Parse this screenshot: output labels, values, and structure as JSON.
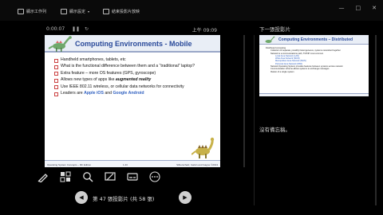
{
  "titlebar": {
    "items": [
      "顯示工作列",
      "顯示設定",
      "結束投影片放映"
    ],
    "controls": [
      "—",
      "□",
      "✕"
    ]
  },
  "presenter": {
    "elapsed": "0:00:07",
    "clock": "上午 09:09",
    "counter": "第 47 張投影片 (共 58 張)"
  },
  "slide": {
    "title": "Computing Environments - Mobile",
    "bullets": [
      [
        "Handheld smartphones, tablets, etc"
      ],
      [
        "What is the functional difference between them and a “traditional” laptop?"
      ],
      [
        "Extra feature – more OS features (GPS, gyroscope)"
      ],
      [
        "Allows new types of apps like ",
        "augmented reality"
      ],
      [
        "Use IEEE 802.11 wireless, or cellular data networks for connectivity"
      ],
      [
        "Leaders are ",
        "Apple iOS",
        " and ",
        "Google Android"
      ]
    ],
    "footer": {
      "left": "Operating System Concepts – 9th Edition",
      "center": "1.43",
      "right": "Silberschatz, Galvin and Gagne ©2013"
    }
  },
  "next_slide": {
    "label": "下一張投影片",
    "title": "Computing Environments – Distributed",
    "lines": [
      {
        "level": 1,
        "text": "Distributed computing"
      },
      {
        "level": 2,
        "text": "Collection of separate, possibly heterogeneous, systems networked together"
      },
      {
        "level": 2,
        "text": "Network is a communications path, TCP/IP most common"
      },
      {
        "level": 3,
        "text": "Local Area Network (LAN)"
      },
      {
        "level": 3,
        "text": "Wide Area Network (WAN)"
      },
      {
        "level": 3,
        "text": "Metropolitan Area Network (MAN)"
      },
      {
        "level": 3,
        "text": "Personal Area Network (PAN)"
      },
      {
        "level": 2,
        "text": "Network Operating System provides features between systems across network"
      },
      {
        "level": 2,
        "text": "Communication scheme allows systems to exchange messages"
      },
      {
        "level": 2,
        "text": "Illusion of a single system"
      }
    ]
  },
  "notes": {
    "text": "沒有備忘稿。"
  },
  "colors": {
    "background": "#000000",
    "slide_title": "#2a4a9a",
    "highlight": "#3060c0"
  }
}
